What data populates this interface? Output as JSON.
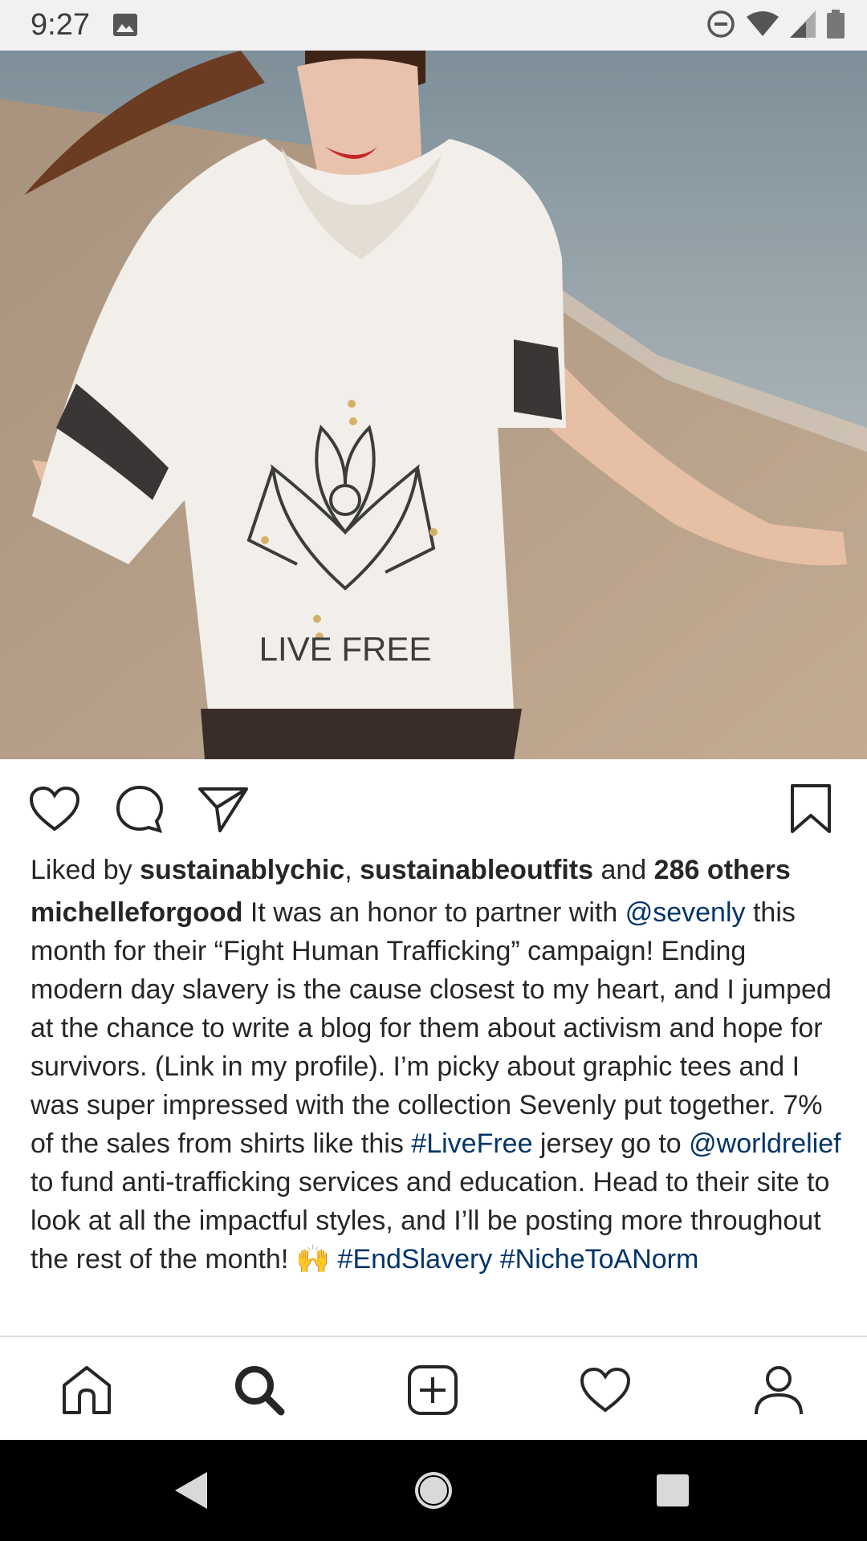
{
  "status_bar": {
    "time": "9:27",
    "icons": [
      "gallery-icon",
      "do-not-disturb-icon",
      "wifi-icon",
      "signal-icon",
      "battery-icon"
    ]
  },
  "post": {
    "image": {
      "shirt_print_text": "LIVE FREE"
    },
    "actions": [
      "heart-icon",
      "comment-icon",
      "share-icon",
      "bookmark-icon"
    ],
    "likes": {
      "prefix": "Liked by ",
      "user1": "sustainablychic",
      "separator": ", ",
      "user2": "sustainableoutfits",
      "middle": " and ",
      "others": "286 others"
    },
    "caption": {
      "username": "michelleforgood",
      "text1": " It was an honor to partner with ",
      "mention1": "@sevenly",
      "text2": " this month for their “Fight Human Trafficking” campaign! Ending modern day slavery is the cause closest to my heart, and I jumped at the chance to write a blog for them about activism and hope for survivors. (Link in my profile). I’m picky about graphic tees and I was super impressed with the collection Sevenly put together. 7% of the sales from shirts like this ",
      "hashtag1": "#LiveFree",
      "text3": " jersey go to ",
      "mention2": "@worldrelief",
      "text4": " to fund anti-trafficking services and education. Head to their site to look at all the impactful styles, and I’ll be posting more throughout the rest of the month! 🙌 ",
      "hashtag2": "#EndSlavery",
      "text5": " ",
      "hashtag3": "#NicheToANorm"
    }
  },
  "bottom_nav": {
    "items": [
      "home-icon",
      "search-icon",
      "add-post-icon",
      "activity-heart-icon",
      "profile-icon"
    ],
    "active": "search-icon"
  },
  "system_nav": [
    "back-icon",
    "home-circle-icon",
    "recents-icon"
  ],
  "colors": {
    "link": "#003569",
    "text": "#262626",
    "status_bar_bg": "#f1f1f1"
  }
}
